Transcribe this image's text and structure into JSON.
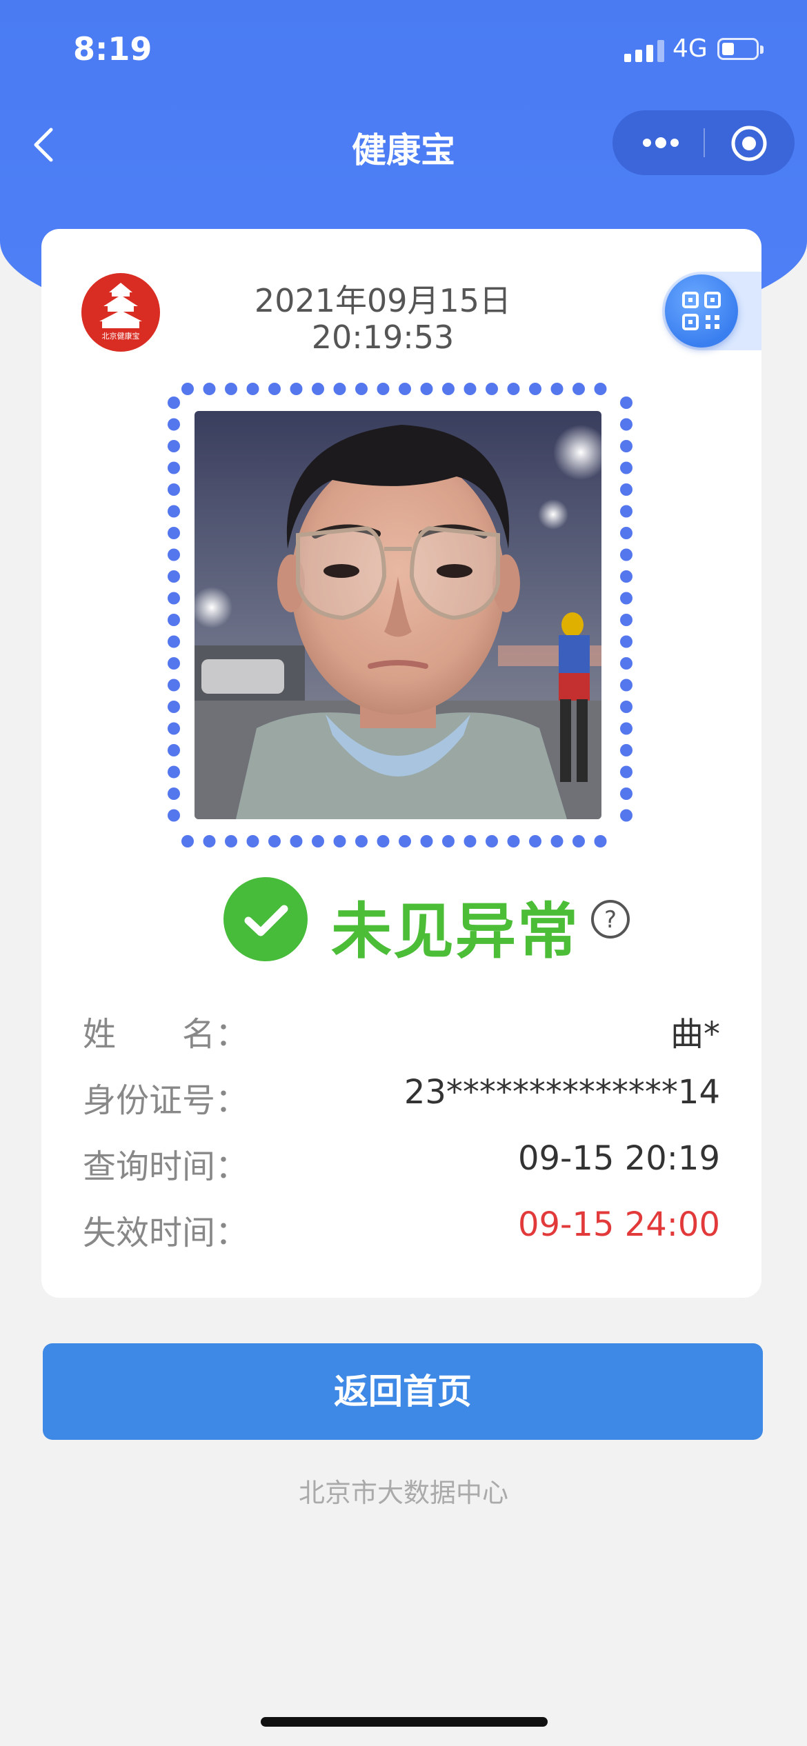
{
  "status_bar": {
    "time": "8:19",
    "network": "4G",
    "battery_level": 0.35
  },
  "nav": {
    "title": "健康宝",
    "back_icon": "chevron-left-icon",
    "more_icon": "more-dots-icon",
    "close_icon": "target-circle-icon"
  },
  "card": {
    "logo_icon": "beijing-jiankangbao-logo",
    "logo_text": "北京健康宝",
    "date": "2021年09月15日",
    "time": "20:19:53",
    "qr_icon": "qr-code-icon",
    "status": "未见异常",
    "status_color": "#4bbd37",
    "fields": [
      {
        "label": "姓　　名：",
        "value": "曲*"
      },
      {
        "label": "身份证号：",
        "value": "23**************14"
      },
      {
        "label": "查询时间：",
        "value": "09-15 20:19"
      },
      {
        "label": "失效时间：",
        "value": "09-15 24:00",
        "value_color": "#e23a3a"
      }
    ]
  },
  "button": {
    "label": "返回首页"
  },
  "footer": {
    "text": "北京市大数据中心"
  }
}
